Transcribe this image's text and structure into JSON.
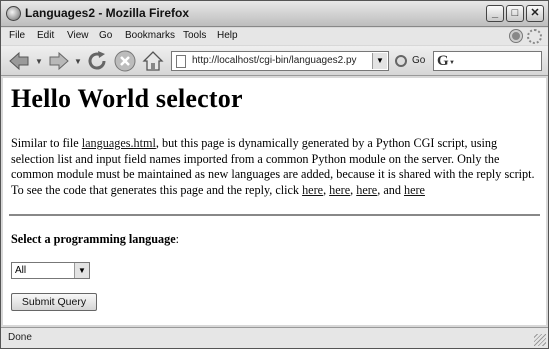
{
  "window": {
    "title": "Languages2 - Mozilla Firefox"
  },
  "menu": [
    "File",
    "Edit",
    "View",
    "Go",
    "Bookmarks",
    "Tools",
    "Help"
  ],
  "toolbar": {
    "url": "http://localhost/cgi-bin/languages2.py",
    "go_label": "Go",
    "search_engine_letter": "G",
    "icons": [
      "back-arrow-icon",
      "forward-arrow-icon",
      "reload-icon",
      "stop-icon",
      "home-icon"
    ]
  },
  "page": {
    "heading": "Hello World selector",
    "para_intro": "Similar to file ",
    "link_languages": "languages.html",
    "para_middle": ", but this page is dynamically generated by a Python CGI script, using selection list and input field names imported from a common Python module on the server. Only the common module must be maintained as new languages are added, because it is shared with the reply script. To see the code that generates this page and the reply, click ",
    "link_here_1": "here",
    "sep_1": ", ",
    "link_here_2": "here",
    "sep_2": ", ",
    "link_here_3": "here",
    "sep_3": ", and ",
    "link_here_4": "here",
    "select_label": "Select a programming language",
    "select_label_suffix": ":",
    "select_value": "All",
    "submit_label": "Submit Query"
  },
  "status": {
    "text": "Done"
  }
}
